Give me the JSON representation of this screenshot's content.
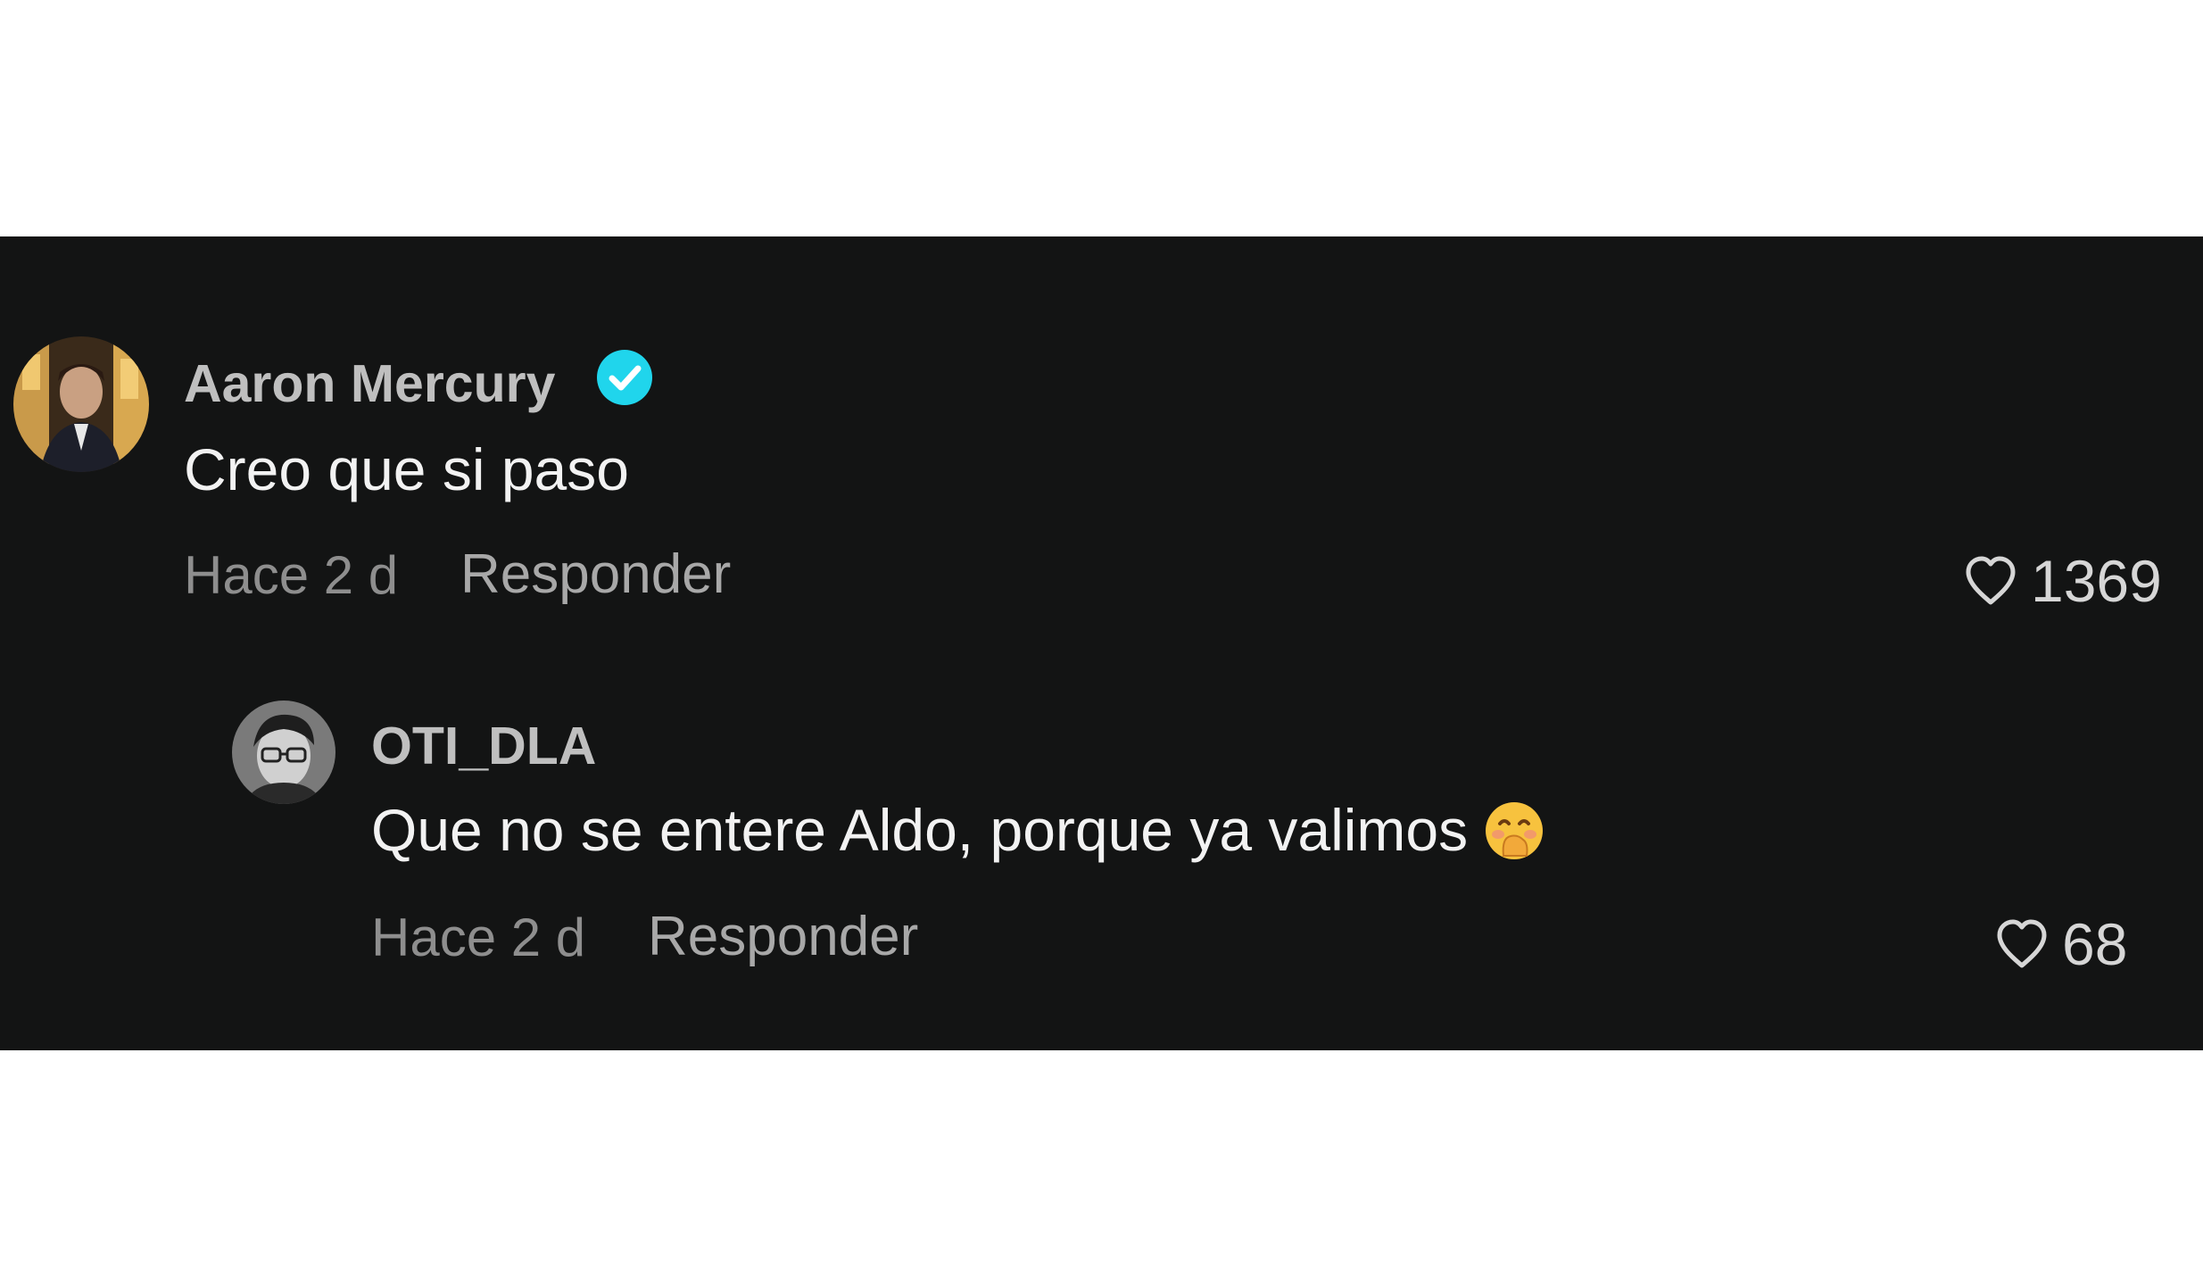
{
  "comments": [
    {
      "username": "Aaron Mercury",
      "verified": true,
      "text": "Creo que si paso",
      "time": "Hace 2 d",
      "reply_label": "Responder",
      "likes": "1369"
    },
    {
      "username": "OTI_DLA",
      "verified": false,
      "text": "Que no se entere Aldo, porque ya valimos",
      "emoji": "face-with-hand-over-mouth-emoji",
      "time": "Hace 2 d",
      "reply_label": "Responder",
      "likes": "68"
    }
  ],
  "colors": {
    "background": "#131414",
    "verified_badge": "#20d5ec",
    "username": "#bfbfbf",
    "text": "#f2f2f2",
    "meta": "#8e8e8e"
  }
}
